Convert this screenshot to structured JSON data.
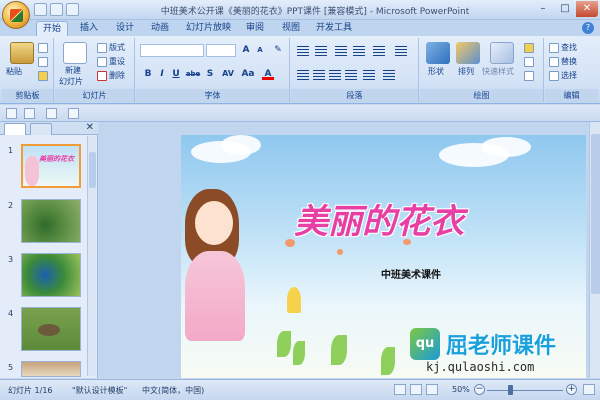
{
  "window": {
    "title": "中班美术公开课《美丽的花衣》PPT课件 [兼容模式] - Microsoft PowerPoint",
    "controls": [
      "–",
      "□",
      "✕"
    ]
  },
  "tabs": [
    {
      "label": "开始",
      "active": true
    },
    {
      "label": "插入"
    },
    {
      "label": "设计"
    },
    {
      "label": "动画"
    },
    {
      "label": "幻灯片放映"
    },
    {
      "label": "审阅"
    },
    {
      "label": "视图"
    },
    {
      "label": "开发工具"
    }
  ],
  "ribbon": {
    "clipboard": {
      "label": "剪贴板",
      "paste": "粘贴"
    },
    "slides": {
      "label": "幻灯片",
      "new_slide": "新建",
      "new_slide_2": "幻灯片",
      "layout": "版式",
      "reset": "重设",
      "delete": "删除"
    },
    "font": {
      "label": "字体",
      "bold": "B",
      "italic": "I",
      "underline": "U",
      "strike": "abe",
      "shadow": "S",
      "spacing": "AV",
      "case": "Aa",
      "color": "A"
    },
    "paragraph": {
      "label": "段落"
    },
    "drawing": {
      "label": "绘图",
      "shape": "形状",
      "arrange": "排列",
      "quick_style": "快速样式"
    },
    "editing": {
      "label": "编辑",
      "find": "查找",
      "replace": "替换",
      "select": "选择"
    }
  },
  "slide": {
    "title": "美丽的花衣",
    "subtitle": "中班美术课件"
  },
  "thumbnails": [
    {
      "num": "1",
      "selected": true,
      "title": "美丽的花衣"
    },
    {
      "num": "2"
    },
    {
      "num": "3"
    },
    {
      "num": "4"
    },
    {
      "num": "5"
    }
  ],
  "watermark": {
    "logo": "qu",
    "text": "屈老师课件",
    "url": "kj.qulaoshi.com"
  },
  "status": {
    "slide": "幻灯片 1/16",
    "template": "\"默认设计模板\"",
    "language": "中文(简体，中国)",
    "zoom": "50%",
    "zoom_level": 0.5
  },
  "colors": {
    "title_pink": "#e83fa5",
    "ribbon_blue": "#15428b",
    "watermark_blue": "#1aa1dd"
  }
}
